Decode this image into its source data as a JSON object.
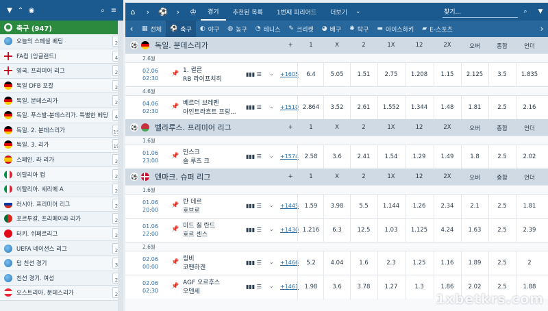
{
  "sidebar": {
    "header_label": "축구 (947)",
    "leagues": [
      {
        "name": "오늘의 스페셜 베팅",
        "count": "2",
        "flag": "world"
      },
      {
        "name": "FA컵 (잉글랜드)",
        "count": "4",
        "flag": "eng"
      },
      {
        "name": "영국. 프리미어 리그",
        "count": "2",
        "flag": "eng"
      },
      {
        "name": "독일 DFB 포칼",
        "count": "2",
        "flag": "ger"
      },
      {
        "name": "독일. 분데스리가",
        "count": "2",
        "flag": "ger"
      },
      {
        "name": "독일. 푸스발-분데스리가. 특별한 베팅",
        "count": "4",
        "flag": "ger"
      },
      {
        "name": "독일. 2. 분데스리가",
        "count": "19",
        "flag": "ger"
      },
      {
        "name": "독일. 3. 리가",
        "count": "19",
        "flag": "ger"
      },
      {
        "name": "스페인. 라 리가",
        "count": "2",
        "flag": "esp"
      },
      {
        "name": "이탈리아 컵",
        "count": "2",
        "flag": "ita"
      },
      {
        "name": "이탈리아. 세리에 A",
        "count": "2",
        "flag": "ita"
      },
      {
        "name": "러시아. 프리미어 리그",
        "count": "2",
        "flag": "rus"
      },
      {
        "name": "포르투갈. 프리메이라 리가",
        "count": "2",
        "flag": "por"
      },
      {
        "name": "터키. 쉬페르리그",
        "count": "2",
        "flag": "tur"
      },
      {
        "name": "UEFA 네이션스 리그",
        "count": "2",
        "flag": "world"
      },
      {
        "name": "텀 친선 경기",
        "count": "3",
        "flag": "world"
      },
      {
        "name": "친선 경기. 여성",
        "count": "2",
        "flag": "world"
      },
      {
        "name": "오스트리아. 분데스리가",
        "count": "2",
        "flag": "aut"
      }
    ]
  },
  "topnav": {
    "items": [
      "경기",
      "추천된 목록",
      "1번째 피리어드",
      "더보기"
    ],
    "search_placeholder": "찾기..."
  },
  "sports": [
    {
      "label": "전체",
      "icon": "▦"
    },
    {
      "label": "축구",
      "icon": "⚽"
    },
    {
      "label": "야구",
      "icon": "◐"
    },
    {
      "label": "농구",
      "icon": "◍"
    },
    {
      "label": "테니스",
      "icon": "◔"
    },
    {
      "label": "크리켓",
      "icon": "✎"
    },
    {
      "label": "배구",
      "icon": "◕"
    },
    {
      "label": "탁구",
      "icon": "✱"
    },
    {
      "label": "아이스하키",
      "icon": "▬"
    },
    {
      "label": "E-스포츠",
      "icon": "▰"
    }
  ],
  "columns": [
    "+",
    "1",
    "X",
    "2",
    "1X",
    "12",
    "2X",
    "오버",
    "종합",
    "언더"
  ],
  "leagues": [
    {
      "name": "독일. 분데스리가",
      "flag": "ger",
      "groups": [
        {
          "date_label": "2.6월",
          "matches": [
            {
              "date": "02.06",
              "time": "02:30",
              "team1": "1. 퀼른",
              "team2": "RB 라이프치히",
              "markets": "+1605",
              "odds": [
                "6.4",
                "5.05",
                "1.51",
                "2.75",
                "1.208",
                "1.15",
                "2.125",
                "3.5",
                "1.835"
              ]
            }
          ]
        },
        {
          "date_label": "4.6월",
          "matches": [
            {
              "date": "04.06",
              "time": "02:30",
              "team1": "베르더 브레멘",
              "team2": "아인트라흐트 프랑...",
              "markets": "+1510",
              "odds": [
                "2.864",
                "3.52",
                "2.61",
                "1.552",
                "1.344",
                "1.48",
                "1.81",
                "2.5",
                "2.16"
              ]
            }
          ]
        }
      ]
    },
    {
      "name": "벨라루스. 프리미어 리그",
      "flag": "blr",
      "groups": [
        {
          "date_label": "1.6월",
          "matches": [
            {
              "date": "01.06",
              "time": "23:00",
              "team1": "민스크",
              "team2": "슬 루츠 크",
              "markets": "+1574",
              "odds": [
                "2.58",
                "3.6",
                "2.41",
                "1.54",
                "1.29",
                "1.49",
                "1.8",
                "2.5",
                "2.02"
              ]
            }
          ]
        }
      ]
    },
    {
      "name": "덴마크. 슈퍼 리그",
      "flag": "den",
      "groups": [
        {
          "date_label": "1.6월",
          "matches": [
            {
              "date": "01.06",
              "time": "20:00",
              "team1": "란 데르",
              "team2": "호브로",
              "markets": "+1445",
              "odds": [
                "1.59",
                "3.98",
                "5.5",
                "1.144",
                "1.26",
                "2.34",
                "2.1",
                "2.5",
                "1.81"
              ]
            },
            {
              "date": "01.06",
              "time": "22:00",
              "team1": "미드 칠 란드",
              "team2": "호르 센스",
              "markets": "+1430",
              "odds": [
                "1.216",
                "6.3",
                "12.5",
                "1.03",
                "1.125",
                "4.24",
                "1.63",
                "2.5",
                "2.39"
              ]
            }
          ]
        },
        {
          "date_label": "2.6월",
          "matches": [
            {
              "date": "02.06",
              "time": "00:00",
              "team1": "링비",
              "team2": "코펜하겐",
              "markets": "+1466",
              "odds": [
                "5.2",
                "4.04",
                "1.6",
                "2.3",
                "1.25",
                "1.16",
                "1.89",
                "2.5",
                "2"
              ]
            },
            {
              "date": "02.06",
              "time": "02:30",
              "team1": "AGF 오르후스",
              "team2": "오덴세",
              "markets": "+1461",
              "odds": [
                "1.98",
                "3.6",
                "3.78",
                "1.27",
                "1.3",
                "1.86",
                "2.02",
                "2.5",
                "1.88"
              ]
            }
          ]
        }
      ]
    }
  ],
  "watermark": "1xbetkrs.com",
  "colors": {
    "header": "#1b5a8e",
    "sportbar": "#28679b",
    "sidebar_head": "#2c8a3f",
    "league_row": "#cfdae4",
    "link": "#2b6ea8"
  }
}
